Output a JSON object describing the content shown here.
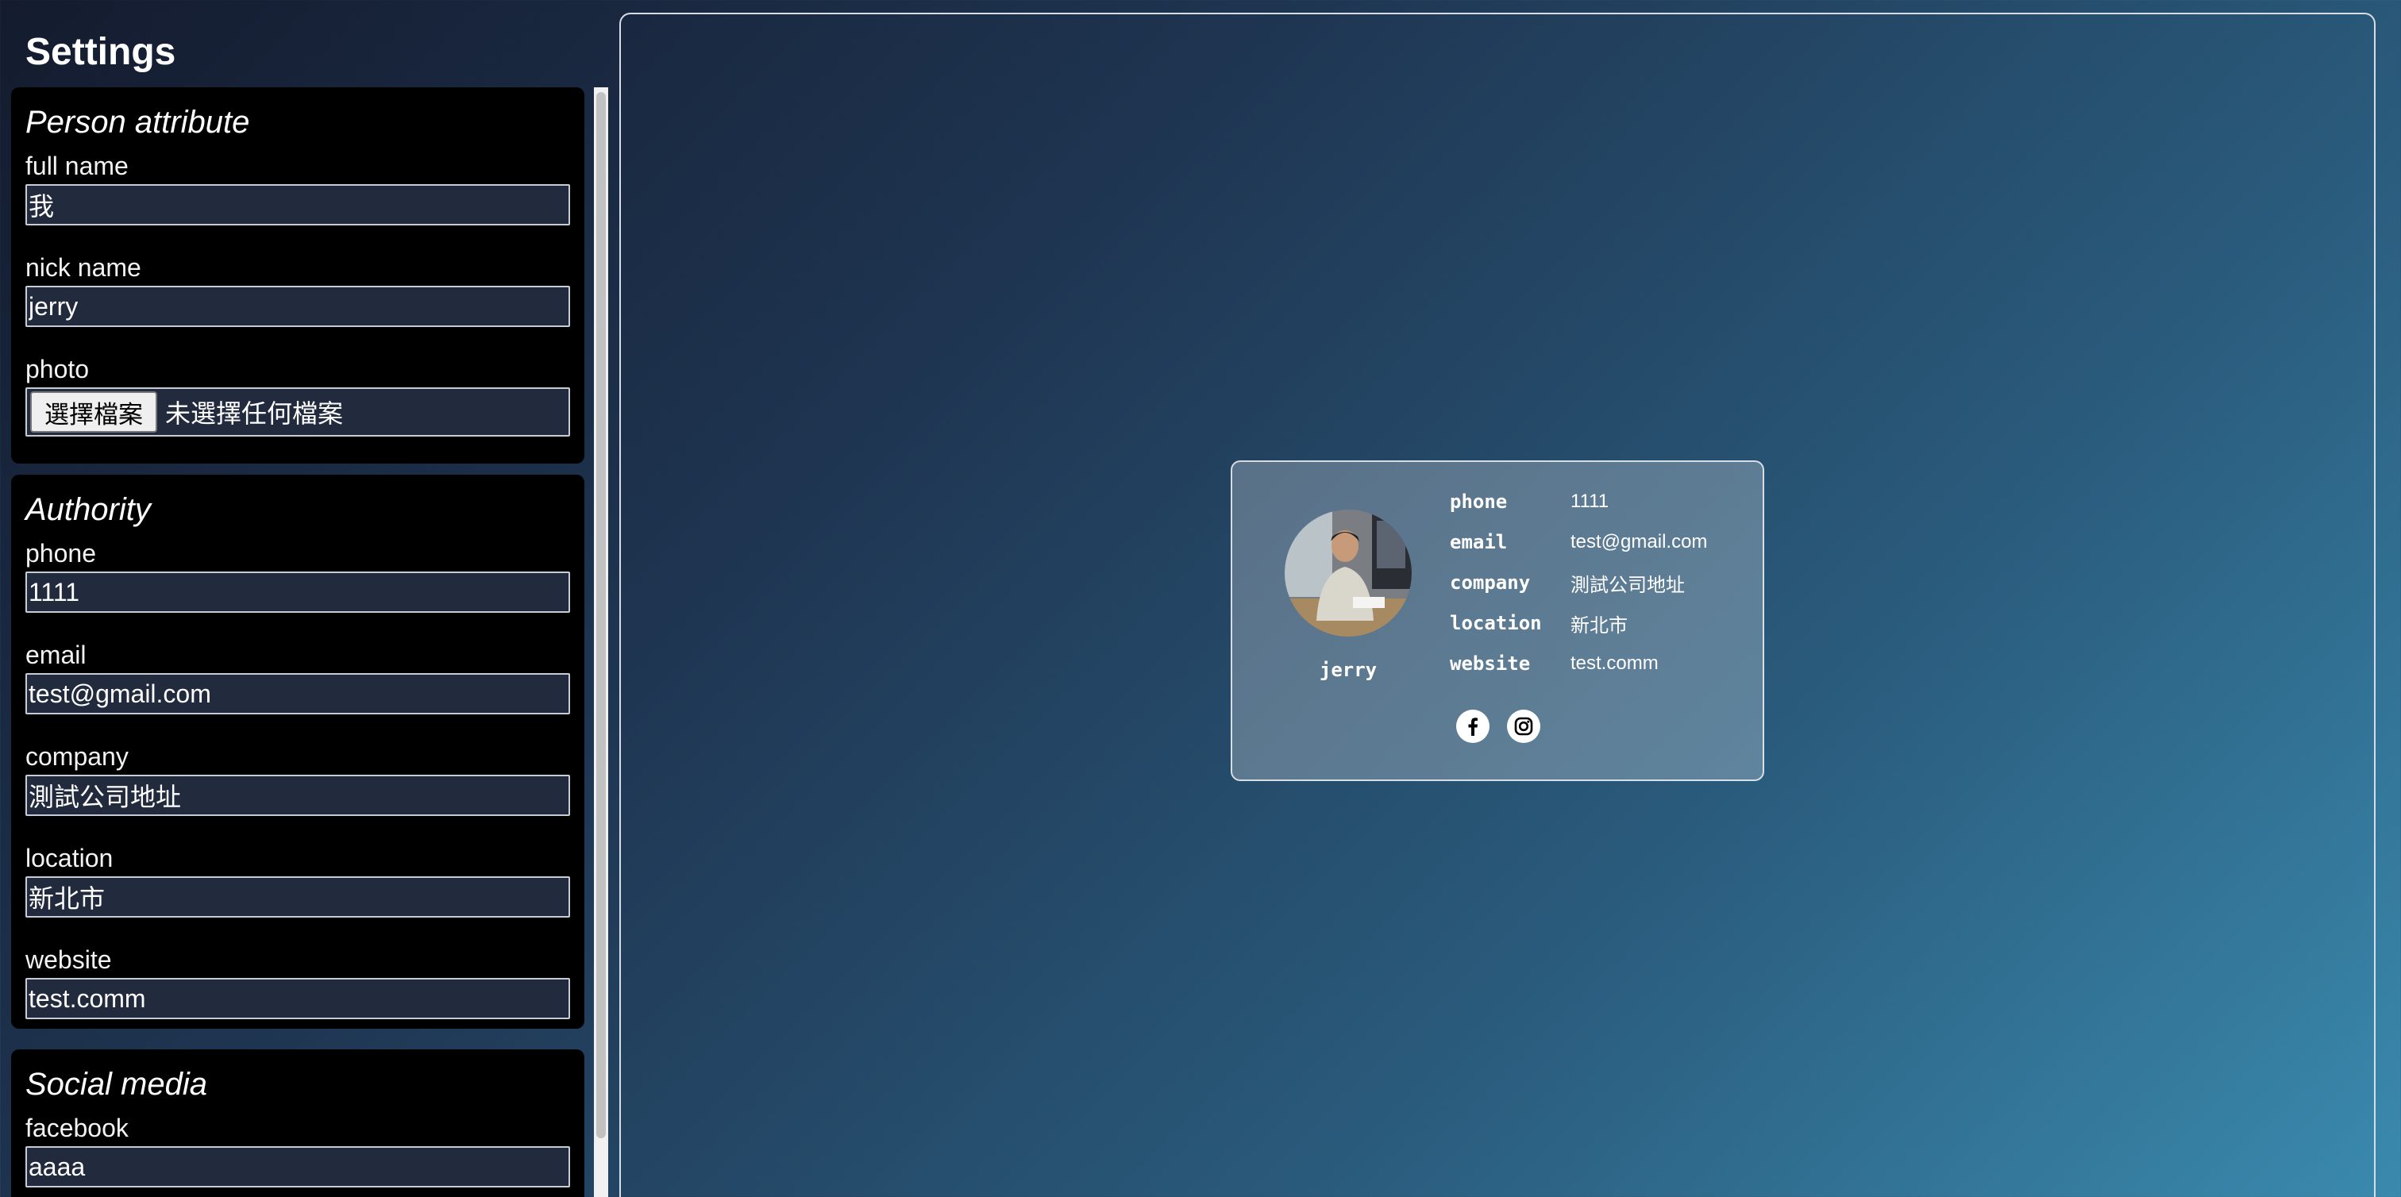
{
  "sidebar": {
    "title": "Settings",
    "sections": {
      "person": {
        "heading": "Person attribute",
        "full_name": {
          "label": "full name",
          "value": "我"
        },
        "nick_name": {
          "label": "nick name",
          "value": "jerry"
        },
        "photo": {
          "label": "photo",
          "button": "選擇檔案",
          "status": "未選擇任何檔案"
        }
      },
      "authority": {
        "heading": "Authority",
        "phone": {
          "label": "phone",
          "value": "1111"
        },
        "email": {
          "label": "email",
          "value": "test@gmail.com"
        },
        "company": {
          "label": "company",
          "value": "測試公司地址"
        },
        "location": {
          "label": "location",
          "value": "新北市"
        },
        "website": {
          "label": "website",
          "value": "test.comm"
        }
      },
      "social": {
        "heading": "Social media",
        "facebook": {
          "label": "facebook",
          "value": "aaaa"
        }
      }
    }
  },
  "card": {
    "nick_name": "jerry",
    "rows": [
      {
        "key": "phone",
        "value": "1111"
      },
      {
        "key": "email",
        "value": "test@gmail.com"
      },
      {
        "key": "company",
        "value": "測試公司地址"
      },
      {
        "key": "location",
        "value": "新北市"
      },
      {
        "key": "website",
        "value": "test.comm"
      }
    ],
    "social_icons": [
      "facebook-icon",
      "instagram-icon"
    ]
  },
  "colors": {
    "panel_bg": "#000000",
    "input_bg": "#222a3d",
    "bg_gradient_start": "#141b2e",
    "bg_gradient_end": "#3a8aae"
  }
}
